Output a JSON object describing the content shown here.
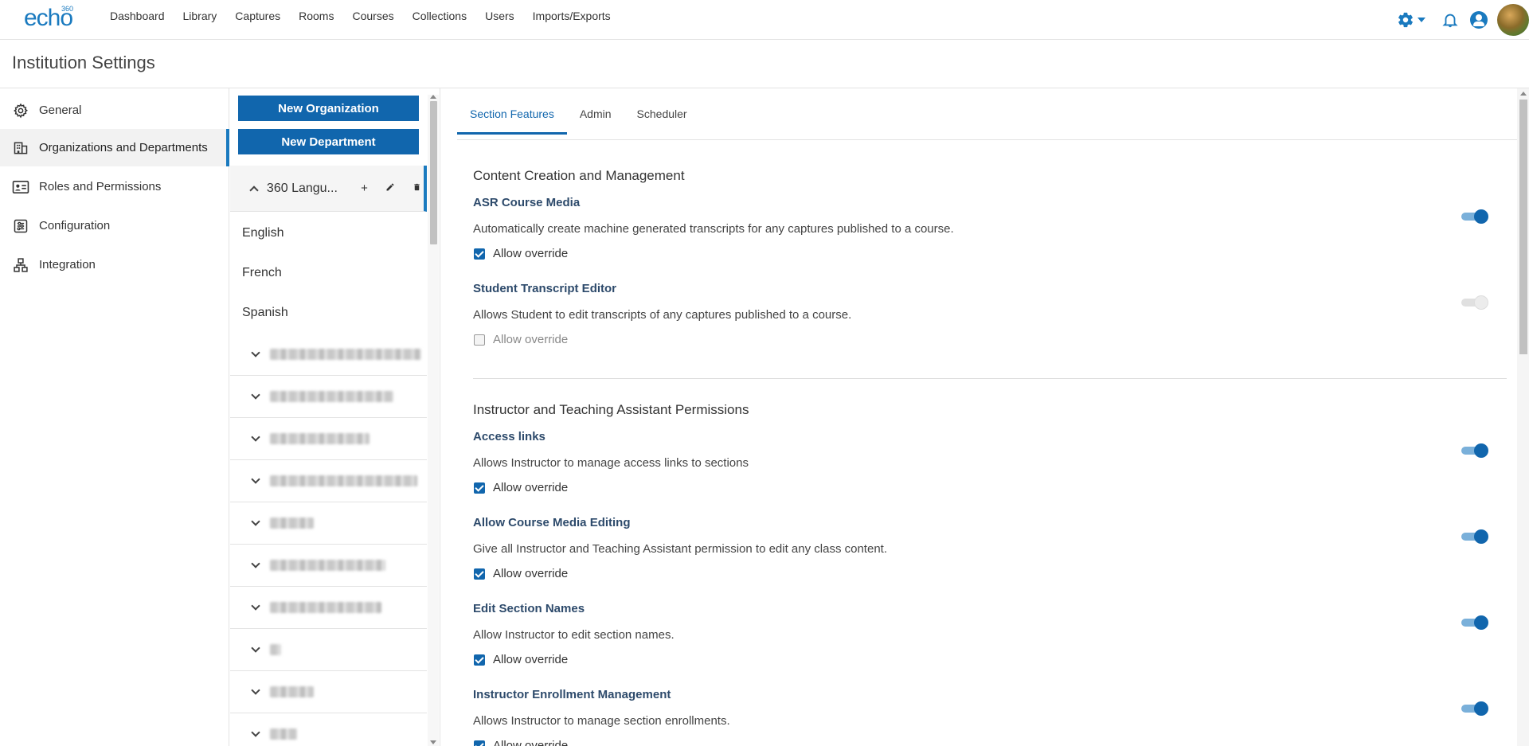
{
  "nav": {
    "logo": "echo",
    "logo_sup": "360",
    "links": [
      "Dashboard",
      "Library",
      "Captures",
      "Rooms",
      "Courses",
      "Collections",
      "Users",
      "Imports/Exports"
    ]
  },
  "page_title": "Institution Settings",
  "sidebar": {
    "items": [
      {
        "label": "General",
        "icon": "gear-icon"
      },
      {
        "label": "Organizations and Departments",
        "icon": "building-icon"
      },
      {
        "label": "Roles and Permissions",
        "icon": "id-card-icon"
      },
      {
        "label": "Configuration",
        "icon": "config-icon"
      },
      {
        "label": "Integration",
        "icon": "network-icon"
      }
    ],
    "active_index": 1
  },
  "orgs": {
    "new_org_label": "New Organization",
    "new_dept_label": "New Department",
    "selected_org": "360 Langu...",
    "add_label": "+",
    "departments": [
      "English",
      "French",
      "Spanish"
    ],
    "collapsed_rows_count_visible": 10
  },
  "tabs": [
    "Section Features",
    "Admin",
    "Scheduler"
  ],
  "active_tab": 0,
  "sections": [
    {
      "heading": "Content Creation and Management",
      "features": [
        {
          "title": "ASR Course Media",
          "desc": "Automatically create machine generated transcripts for any captures published to a course.",
          "override": "Allow override",
          "override_checked": true,
          "enabled": true
        },
        {
          "title": "Student Transcript Editor",
          "desc": "Allows Student to edit transcripts of any captures published to a course.",
          "override": "Allow override",
          "override_checked": false,
          "enabled": false
        }
      ]
    },
    {
      "heading": "Instructor and Teaching Assistant Permissions",
      "features": [
        {
          "title": "Access links",
          "desc": "Allows Instructor to manage access links to sections",
          "override": "Allow override",
          "override_checked": true,
          "enabled": true
        },
        {
          "title": "Allow Course Media Editing",
          "desc": "Give all Instructor and Teaching Assistant permission to edit any class content.",
          "override": "Allow override",
          "override_checked": true,
          "enabled": true
        },
        {
          "title": "Edit Section Names",
          "desc": "Allow Instructor to edit section names.",
          "override": "Allow override",
          "override_checked": true,
          "enabled": true
        },
        {
          "title": "Instructor Enrollment Management",
          "desc": "Allows Instructor to manage section enrollments.",
          "override": "Allow override",
          "override_checked": true,
          "enabled": true
        }
      ]
    }
  ],
  "colors": {
    "accent": "#1166ad",
    "toggle_track_on": "#7ab0da",
    "link_title": "#2d4a6b"
  }
}
